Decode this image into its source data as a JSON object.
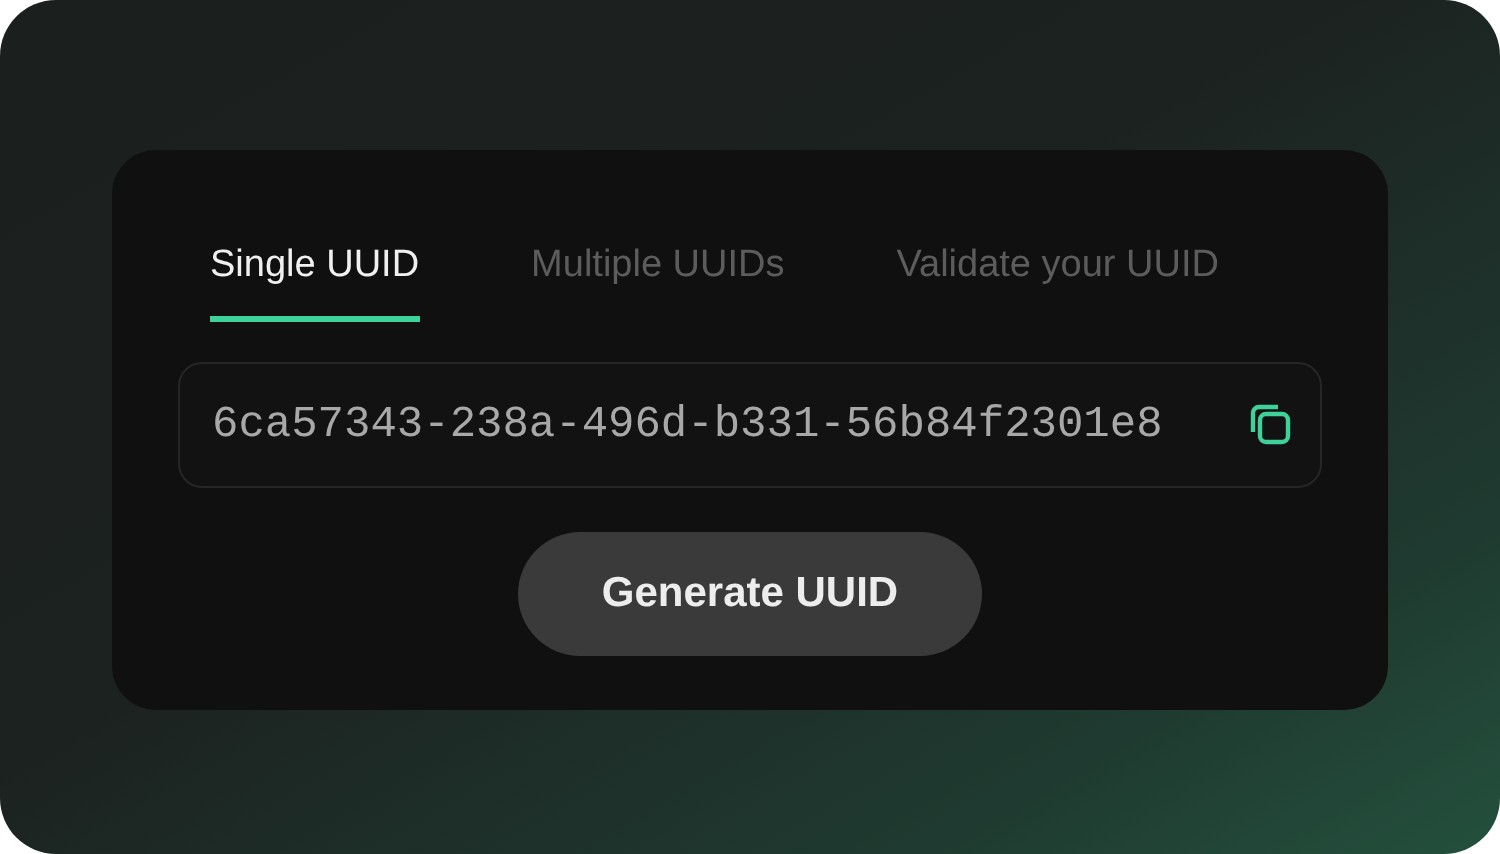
{
  "tabs": [
    {
      "label": "Single UUID",
      "selected": true
    },
    {
      "label": "Multiple UUIDs",
      "selected": false
    },
    {
      "label": "Validate your UUID",
      "selected": false
    }
  ],
  "uuid_field": {
    "value": "6ca57343-238a-496d-b331-56b84f2301e8"
  },
  "generate_button": {
    "label": "Generate UUID"
  }
}
